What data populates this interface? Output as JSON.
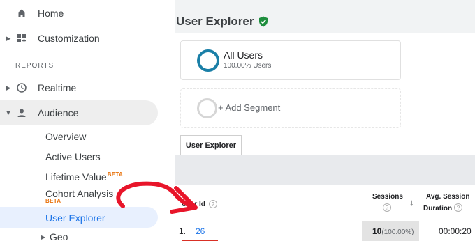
{
  "sidebar": {
    "home": {
      "label": "Home",
      "icon": "home-icon"
    },
    "customization": {
      "label": "Customization",
      "icon": "dashboard-icon"
    },
    "reports_label": "REPORTS",
    "realtime": {
      "label": "Realtime",
      "icon": "clock-icon"
    },
    "audience": {
      "label": "Audience",
      "icon": "person-icon"
    },
    "sub_items": {
      "overview": "Overview",
      "active_users": "Active Users",
      "lifetime_value": "Lifetime Value",
      "lifetime_value_badge": "BETA",
      "cohort_analysis": "Cohort Analysis",
      "cohort_analysis_badge": "BETA",
      "user_explorer": "User Explorer",
      "geo": "Geo"
    }
  },
  "main": {
    "title": "User Explorer",
    "segments": {
      "all_users_name": "All Users",
      "all_users_pct": "100.00% Users",
      "add_segment": "+ Add Segment"
    },
    "tab": "User Explorer",
    "table": {
      "headers": {
        "user_id": "User Id",
        "sessions": "Sessions",
        "avg_session": "Avg. Session",
        "duration": "Duration"
      },
      "rows": [
        {
          "index": "1.",
          "user_id": "26",
          "sessions": "10",
          "sessions_pct": "(100.00%)",
          "avg_duration": "00:00:20"
        }
      ]
    }
  },
  "colors": {
    "active_blue": "#1a73e8",
    "beta_orange": "#e8710a",
    "annotation_red": "#e8152a",
    "segment_ring": "#1a7fa7",
    "shield_green": "#1e8e3e"
  }
}
